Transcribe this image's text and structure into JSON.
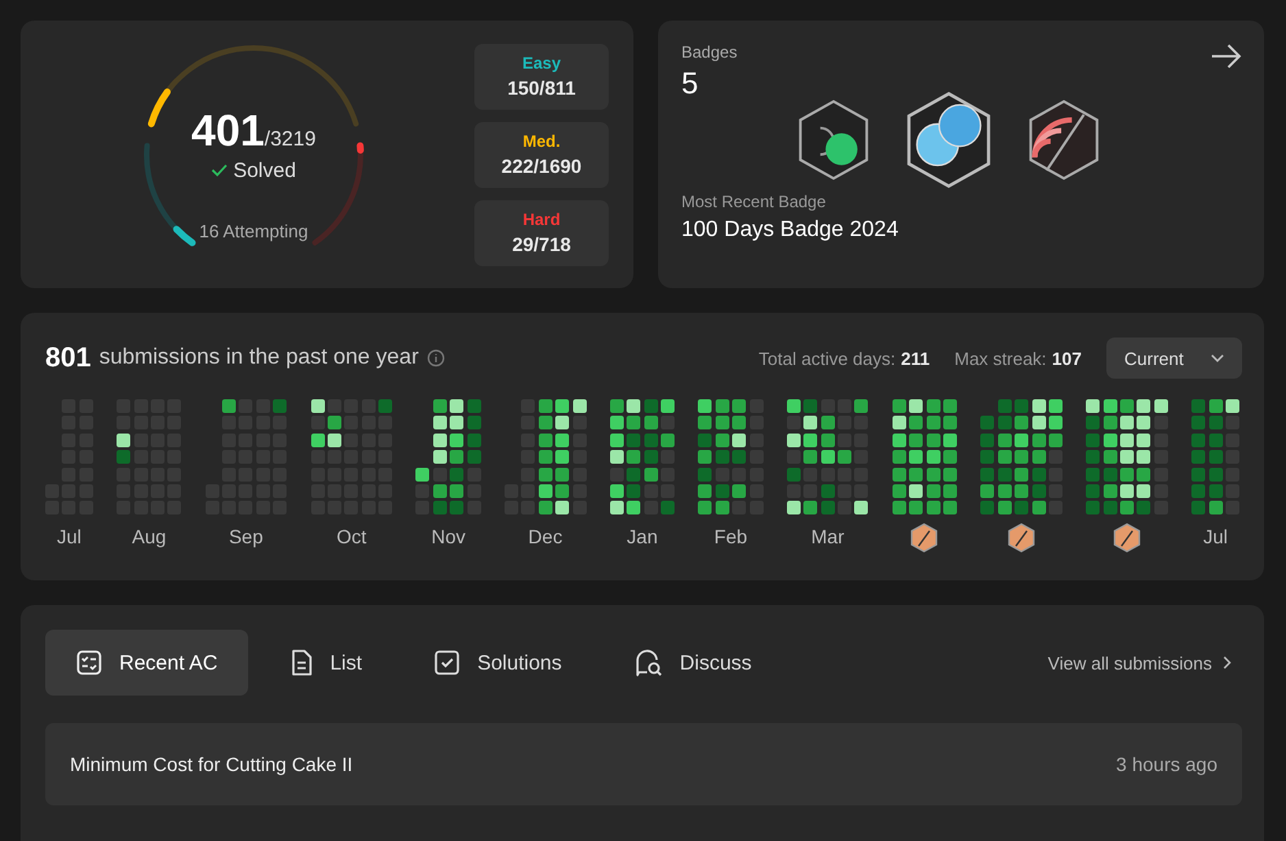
{
  "progress": {
    "solved": "401",
    "total": "/3219",
    "solved_label": "Solved",
    "attempting": "16 Attempting",
    "ring": [
      {
        "kind": "easy",
        "level": 0.185
      },
      {
        "kind": "medium",
        "level": 0.131
      },
      {
        "kind": "hard",
        "level": 0.04
      }
    ],
    "difficulties": [
      {
        "kind": "easy",
        "label": "Easy",
        "count": "150/811"
      },
      {
        "kind": "medium",
        "label": "Med.",
        "count": "222/1690"
      },
      {
        "kind": "hard",
        "label": "Hard",
        "count": "29/718"
      }
    ]
  },
  "badges": {
    "title": "Badges",
    "count": "5",
    "items": [
      {
        "kind": "fifty-days"
      },
      {
        "kind": "hundred-days"
      },
      {
        "kind": "daily"
      }
    ],
    "recent_label": "Most Recent Badge",
    "recent_name": "100 Days Badge 2024"
  },
  "heatmap": {
    "count": "801",
    "caption": "submissions in the past one year",
    "active_label": "Total active days:",
    "active_value": "211",
    "streak_label": "Max streak:",
    "streak_value": "107",
    "dropdown": "Current",
    "months": [
      {
        "kind": "label",
        "label": "Jul"
      },
      {
        "kind": "label",
        "label": "Aug"
      },
      {
        "kind": "label",
        "label": "Sep"
      },
      {
        "kind": "label",
        "label": "Oct"
      },
      {
        "kind": "label",
        "label": "Nov"
      },
      {
        "kind": "label",
        "label": "Dec"
      },
      {
        "kind": "label",
        "label": "Jan"
      },
      {
        "kind": "label",
        "label": "Feb"
      },
      {
        "kind": "label",
        "label": "Mar"
      },
      {
        "kind": "badge"
      },
      {
        "kind": "badge"
      },
      {
        "kind": "badge"
      },
      {
        "kind": "label",
        "label": "Jul"
      }
    ]
  },
  "tabs": [
    {
      "kind": "recent",
      "label": "Recent AC",
      "selected": true
    },
    {
      "kind": "list",
      "label": "List",
      "selected": false
    },
    {
      "kind": "solutions",
      "label": "Solutions",
      "selected": false
    },
    {
      "kind": "discuss",
      "label": "Discuss",
      "selected": false
    }
  ],
  "view_all": "View all submissions",
  "submissions": [
    {
      "title": "Minimum Cost for Cutting Cake II",
      "time": "3 hours ago"
    }
  ]
}
